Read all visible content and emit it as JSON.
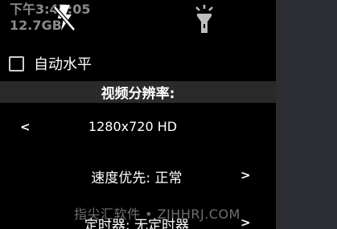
{
  "status": {
    "time": "下午3:47:05",
    "storage": "12.7GB"
  },
  "icons": {
    "flash": "flash-off-icon",
    "torch": "torch-icon"
  },
  "auto_level": {
    "label": "自动水平",
    "checked": false
  },
  "resolution": {
    "title": "视频分辨率:",
    "value": "1280x720 HD",
    "prev": "<"
  },
  "speed": {
    "label": "速度优先: 正常",
    "next": ">"
  },
  "timer": {
    "label": "定时器: 无定时器",
    "next": ">"
  },
  "watermark": "指尖汇软件 • ZJHHRJ.COM"
}
